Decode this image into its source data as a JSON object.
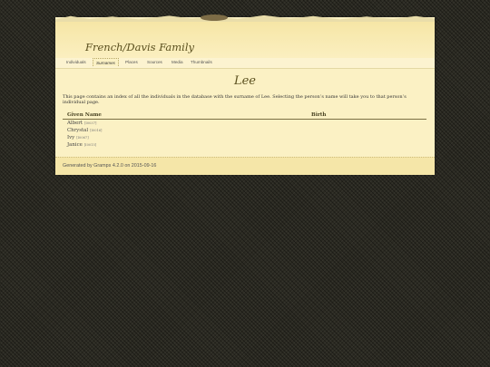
{
  "site": {
    "title": "French/Davis Family"
  },
  "nav": {
    "items": [
      {
        "label": "Individuals"
      },
      {
        "label": "Surnames"
      },
      {
        "label": "Places"
      },
      {
        "label": "Sources"
      },
      {
        "label": "Media"
      },
      {
        "label": "Thumbnails"
      }
    ],
    "active": "Surnames"
  },
  "content": {
    "title": "Lee",
    "description": "This page contains an index of all the individuals in the database with the surname of Lee. Selecting the person’s name will take you to that person’s individual page."
  },
  "table": {
    "headers": {
      "given": "Given Name",
      "birth": "Birth"
    },
    "rows": [
      {
        "name": "Albert",
        "id": "[I0037]"
      },
      {
        "name": "Chrystal",
        "id": "[I0016]"
      },
      {
        "name": "Ivy",
        "id": "[I0067]"
      },
      {
        "name": "Janice",
        "id": "[I0015]"
      }
    ]
  },
  "footer": {
    "text": "Generated by Gramps 4.2.0 on 2015-09-16"
  }
}
